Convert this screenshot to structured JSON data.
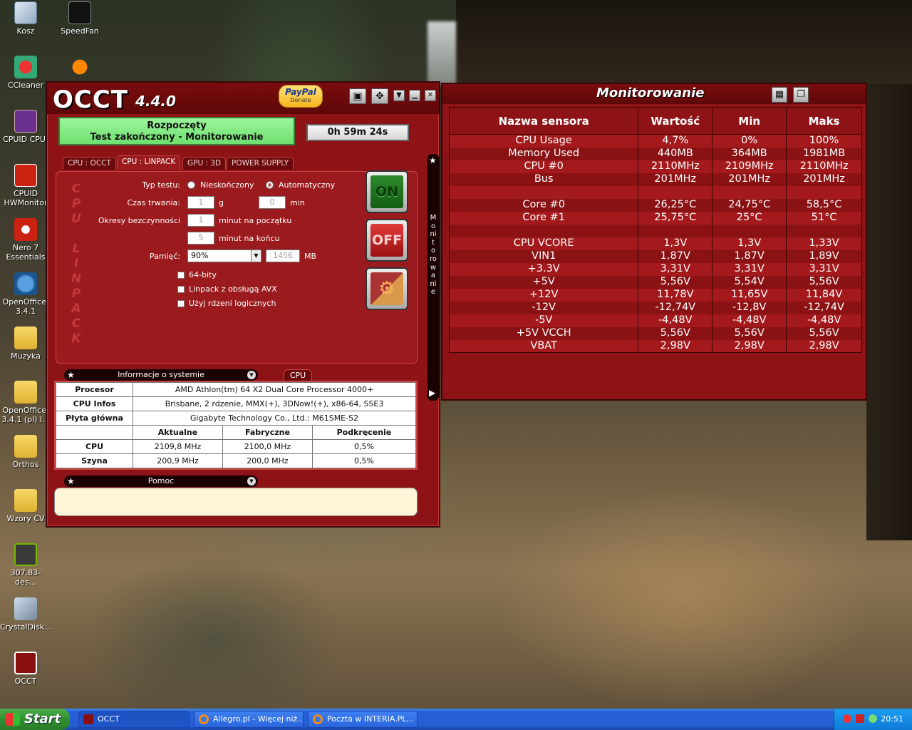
{
  "desktop": {
    "icons": [
      {
        "label": "Kosz",
        "icon": "recycle-bin-icon"
      },
      {
        "label": "SpeedFan",
        "icon": "fan-icon"
      },
      {
        "label": "CCleaner",
        "icon": "ccleaner-icon"
      },
      {
        "label": "CPUID CPU-",
        "icon": "cpuz-icon"
      },
      {
        "label": "CPUID HWMonitor",
        "icon": "hwmonitor-icon"
      },
      {
        "label": "Nero 7 Essentials",
        "icon": "nero-icon"
      },
      {
        "label": "OpenOffice. 3.4.1",
        "icon": "openoffice-icon"
      },
      {
        "label": "Muzyka",
        "icon": "folder-icon"
      },
      {
        "label": "OpenOffice. 3.4.1 (pl) I...",
        "icon": "folder-icon"
      },
      {
        "label": "Orthos",
        "icon": "folder-icon"
      },
      {
        "label": "Wzory CV",
        "icon": "folder-icon"
      },
      {
        "label": "307.83-des...",
        "icon": "nvidia-icon"
      },
      {
        "label": "CrystalDisk...",
        "icon": "crystaldisk-icon"
      },
      {
        "label": "OCCT",
        "icon": "occt-icon"
      }
    ]
  },
  "occt": {
    "logo": "OCCT",
    "version": "4.4.0",
    "paypal": {
      "brand": "PayPal",
      "sub": "Donate"
    },
    "status_line1": "Rozpoczęty",
    "status_line2": "Test zakończony - Monitorowanie",
    "timer": "0h 59m 24s",
    "tabs": [
      "CPU : OCCT",
      "CPU : LINPACK",
      "GPU : 3D",
      "POWER SUPPLY"
    ],
    "active_tab": "CPU : LINPACK",
    "panel_title": "CPU LINPACK",
    "form": {
      "test_type_label": "Typ testu:",
      "opt_infinite": "Nieskończony",
      "opt_auto": "Automatyczny",
      "duration_label": "Czas trwania:",
      "duration_h": "1",
      "duration_h_unit": "g",
      "duration_min": "0",
      "duration_min_unit": "min",
      "idle_label": "Okresy bezczynności",
      "idle_start": "1",
      "idle_start_unit": "minut na początku",
      "idle_end": "5",
      "idle_end_unit": "minut na końcu",
      "memory_label": "Pamięć:",
      "memory_value": "90%",
      "memory_mb": "1456",
      "memory_unit": "MB",
      "opt_64bit": "64-bity",
      "opt_avx": "Linpack z obsługą AVX",
      "opt_logical": "Użyj rdzeni logicznych"
    },
    "buttons": {
      "on": "ON",
      "off": "OFF"
    },
    "side_label": "Monitorowanie",
    "sysinfo_title": "Informacje o systemie",
    "cpu_tab": "CPU",
    "sysinfo": {
      "processor_label": "Procesor",
      "processor_value": "AMD Athlon(tm) 64 X2 Dual Core Processor 4000+",
      "cpuinfo_label": "CPU Infos",
      "cpuinfo_value": "Brisbane, 2 rdzenie, MMX(+), 3DNow!(+), x86-64, SSE3",
      "mobo_label": "Płyta główna",
      "mobo_value": "Gigabyte Technology Co., Ltd.: M61SME-S2",
      "col_current": "Aktualne",
      "col_factory": "Fabryczne",
      "col_oc": "Podkręcenie",
      "rows": [
        {
          "name": "CPU",
          "current": "2109,8 MHz",
          "factory": "2100,0 MHz",
          "oc": "0,5%"
        },
        {
          "name": "Szyna",
          "current": "200,9 MHz",
          "factory": "200,0 MHz",
          "oc": "0,5%"
        }
      ]
    },
    "help_title": "Pomoc"
  },
  "monitor": {
    "title": "Monitorowanie",
    "headers": [
      "Nazwa sensora",
      "Wartość",
      "Min",
      "Maks"
    ],
    "rows": [
      [
        "CPU Usage",
        "4,7%",
        "0%",
        "100%"
      ],
      [
        "Memory Used",
        "440MB",
        "364MB",
        "1981MB"
      ],
      [
        "CPU #0",
        "2110MHz",
        "2109MHz",
        "2110MHz"
      ],
      [
        "Bus",
        "201MHz",
        "201MHz",
        "201MHz"
      ],
      [
        "",
        "",
        "",
        ""
      ],
      [
        "Core #0",
        "26,25°C",
        "24,75°C",
        "58,5°C"
      ],
      [
        "Core #1",
        "25,75°C",
        "25°C",
        "51°C"
      ],
      [
        "",
        "",
        "",
        ""
      ],
      [
        "CPU VCORE",
        "1,3V",
        "1,3V",
        "1,33V"
      ],
      [
        "VIN1",
        "1,87V",
        "1,87V",
        "1,89V"
      ],
      [
        "+3.3V",
        "3,31V",
        "3,31V",
        "3,31V"
      ],
      [
        "+5V",
        "5,56V",
        "5,54V",
        "5,56V"
      ],
      [
        "+12V",
        "11,78V",
        "11,65V",
        "11,84V"
      ],
      [
        "-12V",
        "-12,74V",
        "-12,8V",
        "-12,74V"
      ],
      [
        "-5V",
        "-4,48V",
        "-4,48V",
        "-4,48V"
      ],
      [
        "+5V VCCH",
        "5,56V",
        "5,56V",
        "5,56V"
      ],
      [
        "VBAT",
        "2,98V",
        "2,98V",
        "2,98V"
      ]
    ]
  },
  "taskbar": {
    "start": "Start",
    "tasks": [
      "OCCT",
      "Allegro.pl - Więcej niż...",
      "Poczta w INTERIA.PL..."
    ],
    "clock": "20:51"
  }
}
